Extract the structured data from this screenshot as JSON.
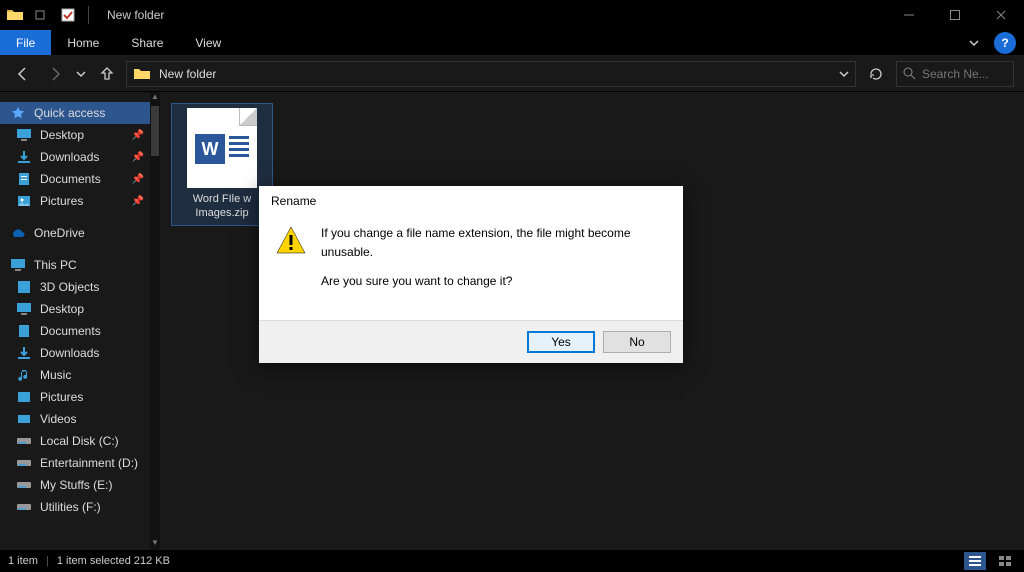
{
  "window": {
    "title": "New folder"
  },
  "ribbon": {
    "file": "File",
    "tabs": [
      "Home",
      "Share",
      "View"
    ]
  },
  "address": {
    "crumb": "New folder",
    "search_placeholder": "Search Ne..."
  },
  "sidebar": {
    "quick_access": {
      "label": "Quick access",
      "items": [
        {
          "label": "Desktop",
          "icon": "desktop",
          "pinned": true
        },
        {
          "label": "Downloads",
          "icon": "downloads",
          "pinned": true
        },
        {
          "label": "Documents",
          "icon": "documents",
          "pinned": true
        },
        {
          "label": "Pictures",
          "icon": "pictures",
          "pinned": true
        }
      ]
    },
    "onedrive": {
      "label": "OneDrive"
    },
    "this_pc": {
      "label": "This PC",
      "items": [
        {
          "label": "3D Objects",
          "icon": "3d"
        },
        {
          "label": "Desktop",
          "icon": "desktop"
        },
        {
          "label": "Documents",
          "icon": "documents"
        },
        {
          "label": "Downloads",
          "icon": "downloads"
        },
        {
          "label": "Music",
          "icon": "music"
        },
        {
          "label": "Pictures",
          "icon": "pictures"
        },
        {
          "label": "Videos",
          "icon": "videos"
        },
        {
          "label": "Local Disk (C:)",
          "icon": "disk"
        },
        {
          "label": "Entertainment (D:)",
          "icon": "disk"
        },
        {
          "label": "My Stuffs (E:)",
          "icon": "disk"
        },
        {
          "label": "Utilities (F:)",
          "icon": "disk"
        }
      ]
    }
  },
  "content": {
    "file": {
      "name_line1": "Word FIle w",
      "name_line2": "Images.zip"
    }
  },
  "status": {
    "count": "1 item",
    "selection": "1 item selected  212 KB"
  },
  "dialog": {
    "title": "Rename",
    "line1": "If you change a file name extension, the file might become unusable.",
    "line2": "Are you sure you want to change it?",
    "yes": "Yes",
    "no": "No"
  }
}
